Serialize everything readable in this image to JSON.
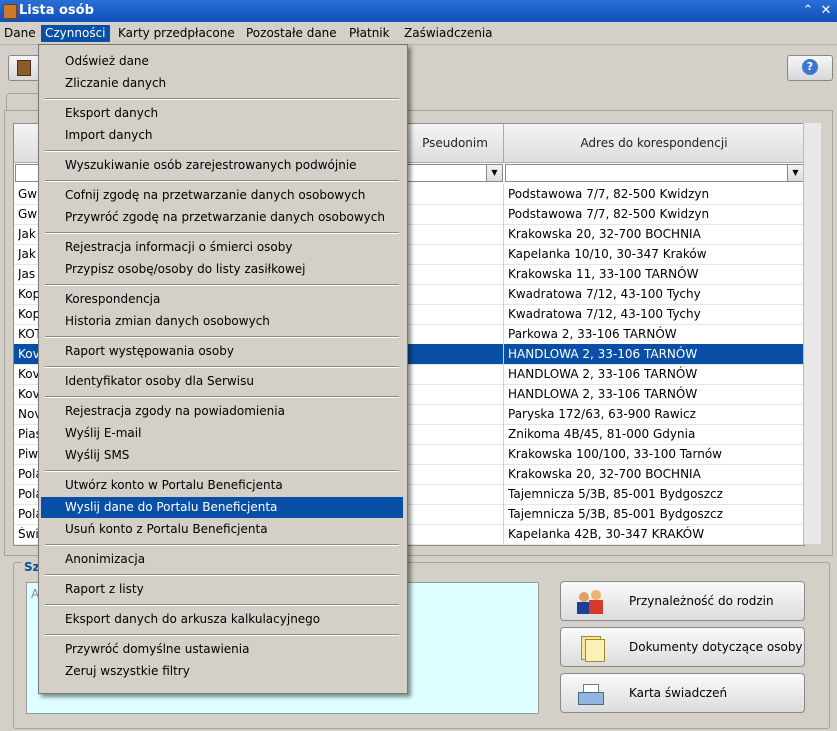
{
  "window": {
    "title": "Lista osób"
  },
  "menubar": [
    "Dane",
    "Czynności",
    "Karty przedpłacone",
    "Pozostałe dane",
    "Płatnik",
    "Zaświadczenia"
  ],
  "grid": {
    "columns": {
      "pseudonim": "Pseudonim",
      "adres": "Adres do korespondencji"
    },
    "rows": [
      {
        "name": "Gwi",
        "address": "Podstawowa 7/7, 82-500 Kwidzyn"
      },
      {
        "name": "Gwi",
        "address": "Podstawowa 7/7, 82-500 Kwidzyn"
      },
      {
        "name": "Jak",
        "address": "Krakowska 20, 32-700 BOCHNIA"
      },
      {
        "name": "Jak",
        "address": "Kapelanka 10/10, 30-347 Kraków"
      },
      {
        "name": "Jas",
        "address": "Krakowska 11, 33-100 TARNÓW"
      },
      {
        "name": "Kop",
        "address": "Kwadratowa 7/12, 43-100 Tychy"
      },
      {
        "name": "Kop",
        "address": "Kwadratowa 7/12, 43-100 Tychy"
      },
      {
        "name": "KOT",
        "address": "Parkowa 2, 33-106 TARNÓW"
      },
      {
        "name": "Kov",
        "address": "HANDLOWA 2, 33-106 TARNÓW"
      },
      {
        "name": "Kov",
        "address": "HANDLOWA 2, 33-106 TARNÓW"
      },
      {
        "name": "Kov",
        "address": "HANDLOWA 2, 33-106 TARNÓW"
      },
      {
        "name": "Nov",
        "address": "Paryska 172/63, 63-900 Rawicz"
      },
      {
        "name": "Pias",
        "address": "Znikoma 4B/45, 81-000 Gdynia"
      },
      {
        "name": "Piw",
        "address": "Krakowska 100/100, 33-100 Tarnów"
      },
      {
        "name": "Pola",
        "address": "Krakowska 20, 32-700 BOCHNIA"
      },
      {
        "name": "Pola",
        "address": "Tajemnicza 5/3B, 85-001 Bydgoszcz"
      },
      {
        "name": "Pola",
        "address": "Tajemnicza 5/3B, 85-001 Bydgoszcz"
      },
      {
        "name": "Świ",
        "address": "Kapelanka 42B, 30-347 KRAKÓW"
      }
    ],
    "selected_index": 8
  },
  "bottom": {
    "title": "Sz",
    "textarea_text": "A",
    "buttons": [
      {
        "label": "Przynależność do rodzin",
        "icon": "family-icon"
      },
      {
        "label": "Dokumenty dotyczące osoby",
        "icon": "documents-icon"
      },
      {
        "label": "Karta świadczeń",
        "icon": "printer-icon"
      }
    ]
  },
  "dropdown": {
    "groups": [
      [
        "Odśwież dane",
        "Zliczanie danych"
      ],
      [
        "Eksport danych",
        "Import danych"
      ],
      [
        "Wyszukiwanie osób zarejestrowanych podwójnie"
      ],
      [
        "Cofnij zgodę na przetwarzanie danych osobowych",
        "Przywróć zgodę na przetwarzanie danych osobowych"
      ],
      [
        "Rejestracja informacji o śmierci osoby",
        "Przypisz osobę/osoby do listy zasiłkowej"
      ],
      [
        "Korespondencja",
        "Historia zmian danych osobowych"
      ],
      [
        "Raport występowania osoby"
      ],
      [
        "Identyfikator osoby dla Serwisu"
      ],
      [
        "Rejestracja zgody na powiadomienia",
        "Wyślij E-mail",
        "Wyślij SMS"
      ],
      [
        "Utwórz konto w Portalu Beneficjenta",
        "Wyslij dane do Portalu Beneficjenta",
        "Usuń konto z Portalu Beneficjenta"
      ],
      [
        "Anonimizacja"
      ],
      [
        "Raport z listy"
      ],
      [
        "Eksport danych do arkusza kalkulacyjnego"
      ],
      [
        "Przywróć domyślne ustawienia",
        "Zeruj wszystkie filtry"
      ]
    ],
    "highlighted": "Wyslij dane do Portalu Beneficjenta"
  },
  "help_label": "?"
}
